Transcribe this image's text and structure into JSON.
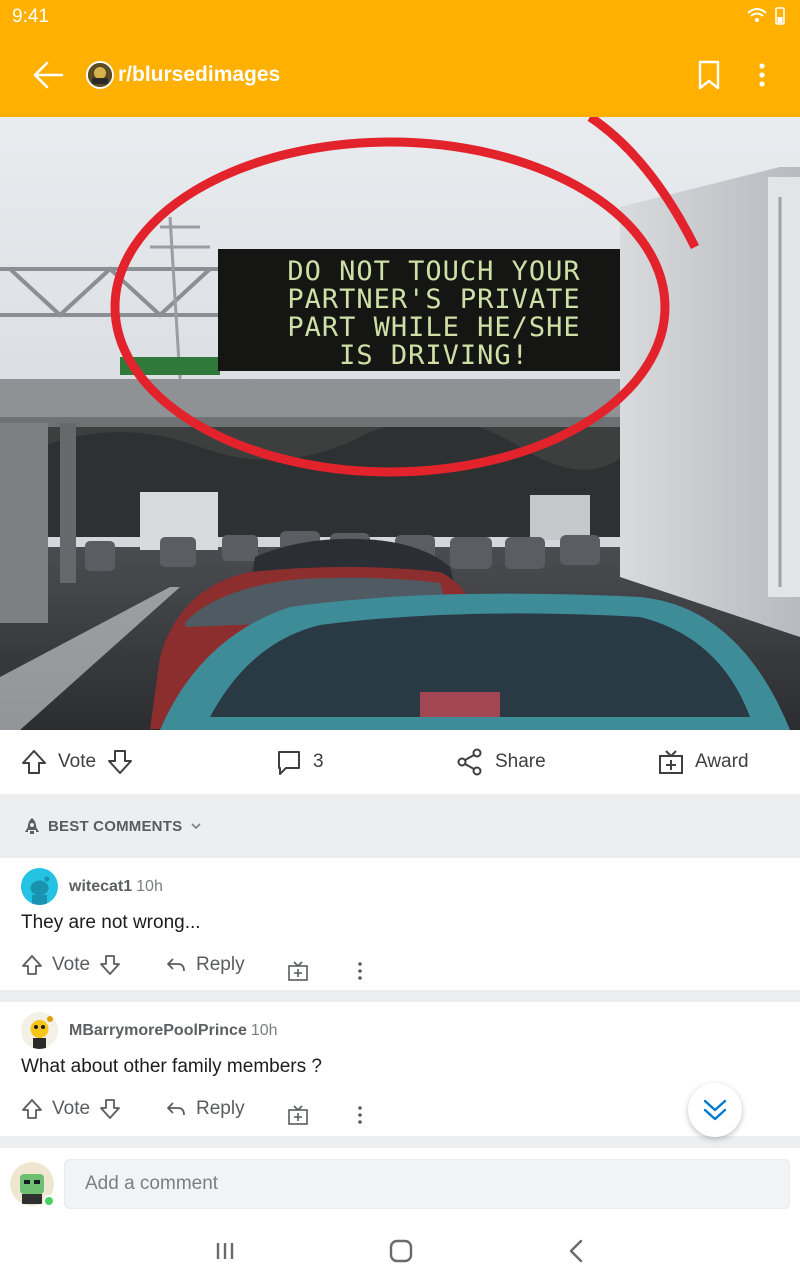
{
  "status_bar": {
    "time": "9:41"
  },
  "header": {
    "subreddit": "r/blursedimages"
  },
  "post": {
    "sign_lines": [
      "DO NOT TOUCH YOUR",
      "PARTNER'S PRIVATE",
      "PART WHILE HE/SHE",
      "IS DRIVING!"
    ],
    "actions": {
      "vote_label": "Vote",
      "comment_count": "3",
      "share_label": "Share",
      "award_label": "Award"
    }
  },
  "sort": {
    "label": "BEST COMMENTS"
  },
  "comments": [
    {
      "author": "witecat1",
      "time": "10h",
      "body": "They are not wrong...",
      "vote_label": "Vote",
      "reply_label": "Reply"
    },
    {
      "author": "MBarrymorePoolPrince",
      "time": "10h",
      "body": "What about other family members ?",
      "vote_label": "Vote",
      "reply_label": "Reply"
    }
  ],
  "composer": {
    "placeholder": "Add a comment"
  },
  "colors": {
    "brand": "#ffb000",
    "online": "#46d160",
    "accent_blue": "#0079d3"
  }
}
